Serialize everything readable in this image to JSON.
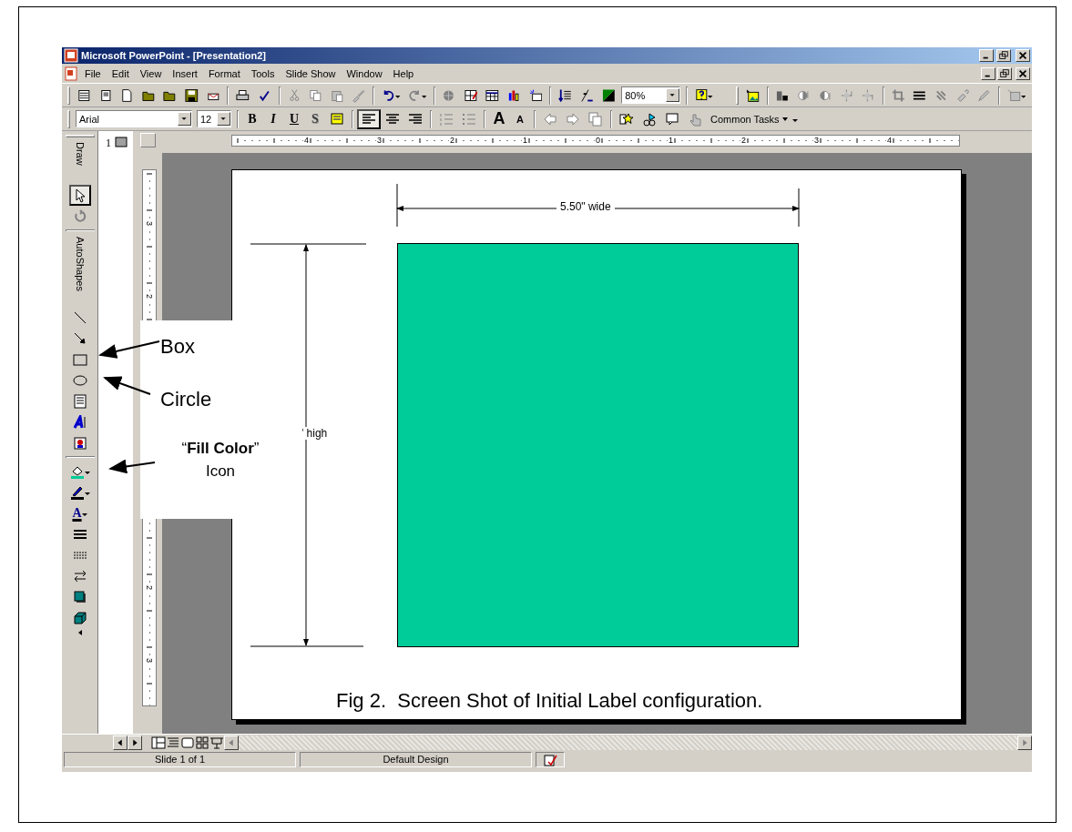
{
  "window": {
    "title": "Microsoft PowerPoint - [Presentation2]"
  },
  "menu": [
    {
      "label": "File"
    },
    {
      "label": "Edit"
    },
    {
      "label": "View"
    },
    {
      "label": "Insert"
    },
    {
      "label": "Format"
    },
    {
      "label": "Tools"
    },
    {
      "label": "Slide Show"
    },
    {
      "label": "Window"
    },
    {
      "label": "Help"
    }
  ],
  "standard_toolbar": {
    "zoom": "80%"
  },
  "formatting_toolbar": {
    "font": "Arial",
    "size": "12",
    "bold": "B",
    "italic": "I",
    "underline": "U",
    "shadow": "S",
    "grow_font": "A",
    "shrink_font": "A",
    "common_tasks": "Common Tasks",
    "alignment": [
      {
        "selected": true
      },
      {
        "selected": false
      },
      {
        "selected": false
      }
    ]
  },
  "draw_toolbar": {
    "draw": "Draw",
    "autoshapes": "AutoShapes",
    "font_color": "A",
    "select_tool": {
      "selected": true
    }
  },
  "slides_pane": {
    "number": "1"
  },
  "rulers": {
    "horizontal": [
      "4",
      "3",
      "2",
      "1",
      "0",
      "1",
      "2",
      "3",
      "4"
    ],
    "vertical": [
      "3",
      "2",
      "2",
      "3"
    ]
  },
  "slide": {
    "width_label": "5.50\" wide",
    "height_label": "\" high",
    "caption": "Fig 2.  Screen Shot of Initial Label configuration."
  },
  "annotations": [
    {
      "text": "Box"
    },
    {
      "text": "Circle"
    },
    {
      "text": "“**Fill Color**” Icon"
    }
  ],
  "status_bar": [
    {
      "text": "Slide 1 of 1"
    },
    {
      "text": "Default Design"
    }
  ]
}
